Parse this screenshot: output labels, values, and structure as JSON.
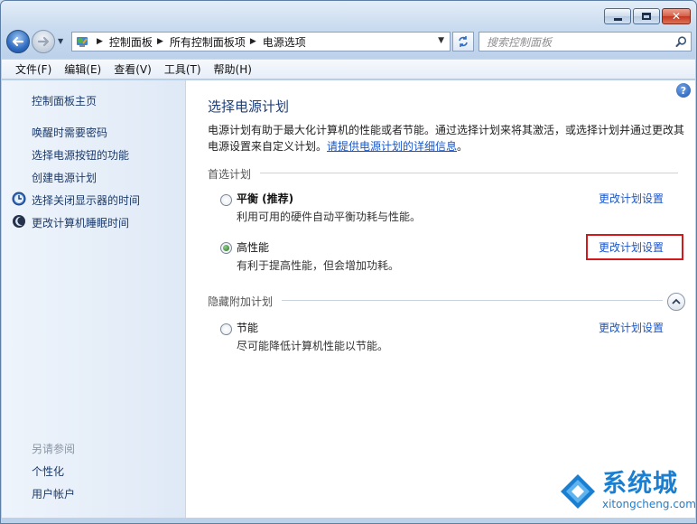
{
  "window": {
    "caption": {
      "minimize_icon": "minimize-icon",
      "maximize_icon": "maximize-icon",
      "close_icon": "close-icon"
    }
  },
  "address": {
    "crumbs": [
      "控制面板",
      "所有控制面板项",
      "电源选项"
    ],
    "search_placeholder": "搜索控制面板"
  },
  "menu": [
    "文件(F)",
    "编辑(E)",
    "查看(V)",
    "工具(T)",
    "帮助(H)"
  ],
  "sidebar": {
    "home": "控制面板主页",
    "links": [
      "唤醒时需要密码",
      "选择电源按钮的功能",
      "创建电源计划",
      "选择关闭显示器的时间",
      "更改计算机睡眠时间"
    ],
    "see_also_title": "另请参阅",
    "see_also": [
      "个性化",
      "用户帐户"
    ]
  },
  "main": {
    "help": "?",
    "title": "选择电源计划",
    "description": "电源计划有助于最大化计算机的性能或者节能。通过选择计划来将其激活，或选择计划并通过更改其电源设置来自定义计划。",
    "description_link": "请提供电源计划的详细信息",
    "description_end": "。",
    "preferred_label": "首选计划",
    "hidden_label": "隐藏附加计划",
    "plans": [
      {
        "name": "平衡 (推荐)",
        "desc": "利用可用的硬件自动平衡功耗与性能。",
        "link": "更改计划设置",
        "selected": false
      },
      {
        "name": "高性能",
        "desc": "有利于提高性能，但会增加功耗。",
        "link": "更改计划设置",
        "selected": true
      },
      {
        "name": "节能",
        "desc": "尽可能降低计算机性能以节能。",
        "link": "更改计划设置",
        "selected": false
      }
    ]
  },
  "watermark": {
    "name": "系统城",
    "url": "xitongcheng.com"
  }
}
